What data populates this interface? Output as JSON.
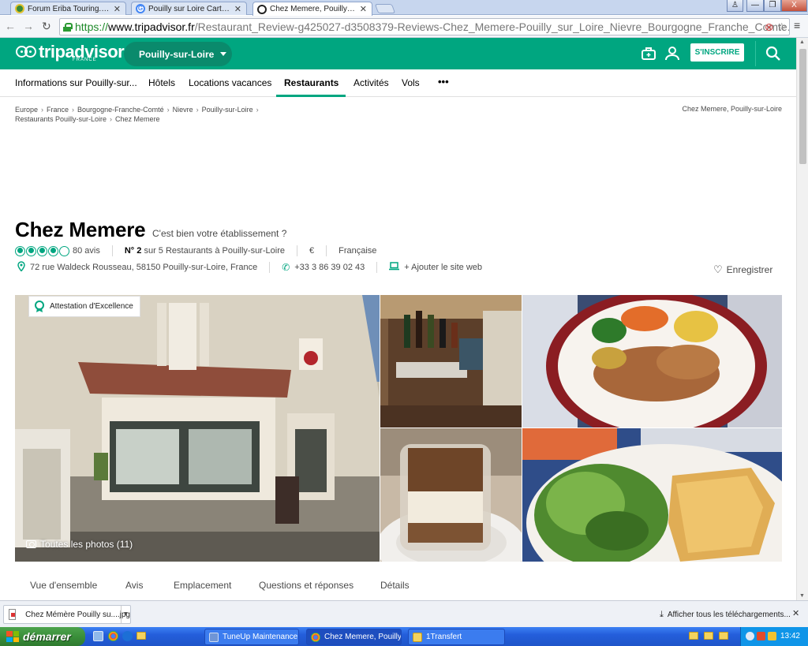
{
  "browser": {
    "tabs": [
      {
        "title": "Forum Eriba Touring.com • C",
        "favicon_color": "#3a8a3a"
      },
      {
        "title": "Pouilly sur Loire Cartes posta",
        "favicon_color": "#4285f4"
      },
      {
        "title": "Chez Memere, Pouilly-sur-Lo",
        "favicon_color": "#222222"
      }
    ],
    "active_tab": 2,
    "url": {
      "scheme": "https://",
      "host": "www.tripadvisor.fr",
      "path": "/Restaurant_Review-g425027-d3508379-Reviews-Chez_Memere-Pouilly_sur_Loire_Nievre_Bourgogne_Franche_Comte.html"
    },
    "window_buttons": {
      "user": "♙",
      "minimize": "—",
      "restore": "❐",
      "close": "X"
    }
  },
  "site": {
    "brand_color": "#00a680",
    "logo": {
      "text": "tripadvisor",
      "sub": "FRANCE"
    },
    "geo_pill": "Pouilly-sur-Loire",
    "signin_label": "S'INSCRIRE",
    "nav": [
      "Informations sur Pouilly-sur...",
      "Hôtels",
      "Locations vacances",
      "Restaurants",
      "Activités",
      "Vols",
      "•••"
    ],
    "active_nav": "Restaurants"
  },
  "breadcrumbs": {
    "items": [
      "Europe",
      "France",
      "Bourgogne-Franche-Comté",
      "Nievre",
      "Pouilly-sur-Loire",
      "Restaurants Pouilly-sur-Loire",
      "Chez Memere"
    ],
    "right": "Chez Memere, Pouilly-sur-Loire"
  },
  "restaurant": {
    "name": "Chez Memere",
    "claim": "C'est bien votre établissement ?",
    "rating_bubbles": 4,
    "rating_max": 5,
    "reviews": "80 avis",
    "rank_number": "N° 2",
    "rank_text": "sur 5 Restaurants à Pouilly-sur-Loire",
    "price": "€",
    "cuisine": "Française",
    "address": "72 rue Waldeck Rousseau, 58150 Pouilly-sur-Loire, France",
    "phone": "+33 3 86 39 02 43",
    "website": "+ Ajouter le site web",
    "save_label": "Enregistrer",
    "badge": "Attestation d'Excellence",
    "all_photos": "Toutes les photos (11)"
  },
  "section_tabs": [
    "Vue d'ensemble",
    "Avis",
    "Emplacement",
    "Questions et réponses",
    "Détails"
  ],
  "downloads": {
    "file": "Chez Mémère Pouilly su....jpg",
    "show_all": "Afficher tous les téléchargements..."
  },
  "taskbar": {
    "start": "démarrer",
    "tasks": [
      "TuneUp Maintenance ...",
      "Chez Memere, Pouilly...",
      "1Transfert"
    ],
    "clock": "13:42"
  }
}
